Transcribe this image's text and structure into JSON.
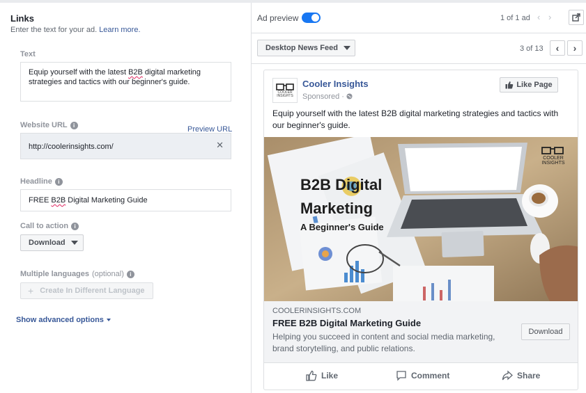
{
  "links": {
    "title": "Links",
    "subtitle": "Enter the text for your ad.",
    "learn_more": "Learn more."
  },
  "fields": {
    "text_label": "Text",
    "text_value_pre": "Equip yourself with the latest ",
    "text_value_b2b": "B2B",
    "text_value_post": " digital marketing strategies and tactics with our beginner's guide.",
    "website_url_label": "Website URL",
    "preview_url": "Preview URL",
    "website_url_value": "http://coolerinsights.com/",
    "headline_label": "Headline",
    "headline_pre": "FREE ",
    "headline_b2b": "B2B",
    "headline_post": " Digital Marketing Guide",
    "cta_label": "Call to action",
    "cta_value": "Download",
    "multi_lang_label": "Multiple languages",
    "multi_lang_optional": "(optional)",
    "create_lang_button": "Create In Different Language",
    "advanced_options": "Show advanced options"
  },
  "preview": {
    "ad_preview_label": "Ad preview",
    "toggle_on": true,
    "ad_count": "1 of 1 ad",
    "placement": "Desktop News Feed",
    "placement_count": "3 of 13"
  },
  "ad": {
    "page_name": "Cooler Insights",
    "logo_text_1": "COOLER",
    "logo_text_2": "INSIGHTS",
    "sponsored": "Sponsored ·",
    "like_page": "Like Page",
    "primary_text": "Equip yourself with the latest B2B digital marketing strategies and tactics with our beginner's guide.",
    "image_title_1": "B2B Digital",
    "image_title_2": "Marketing",
    "image_subtitle": "A Beginner's Guide",
    "image_logo_1": "COOLER",
    "image_logo_2": "INSIGHTS",
    "domain": "COOLERINSIGHTS.COM",
    "headline": "FREE B2B Digital Marketing Guide",
    "description": "Helping you succeed in content and social media marketing, brand storytelling, and public relations.",
    "cta": "Download",
    "actions": {
      "like": "Like",
      "comment": "Comment",
      "share": "Share"
    }
  },
  "colors": {
    "link": "#385898",
    "toggle": "#1877f2",
    "label_grey": "#90949c"
  }
}
